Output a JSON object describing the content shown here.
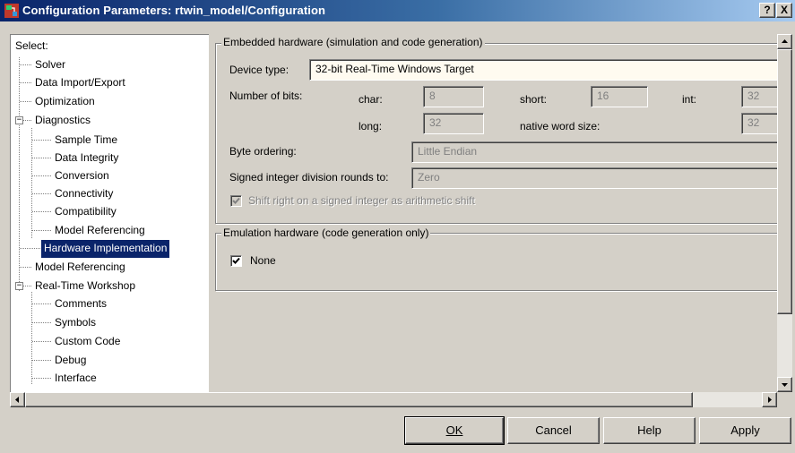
{
  "window": {
    "title": "Configuration Parameters: rtwin_model/Configuration",
    "help_button": "?",
    "close_button": "X"
  },
  "tree": {
    "select_label": "Select:",
    "items": [
      {
        "label": "Solver"
      },
      {
        "label": "Data Import/Export"
      },
      {
        "label": "Optimization"
      },
      {
        "label": "Diagnostics"
      },
      {
        "label": "Sample Time"
      },
      {
        "label": "Data Integrity"
      },
      {
        "label": "Conversion"
      },
      {
        "label": "Connectivity"
      },
      {
        "label": "Compatibility"
      },
      {
        "label": "Model Referencing"
      },
      {
        "label": "Hardware Implementation"
      },
      {
        "label": "Model Referencing"
      },
      {
        "label": "Real-Time Workshop"
      },
      {
        "label": "Comments"
      },
      {
        "label": "Symbols"
      },
      {
        "label": "Custom Code"
      },
      {
        "label": "Debug"
      },
      {
        "label": "Interface"
      }
    ],
    "selected": "Hardware Implementation"
  },
  "embedded": {
    "legend": "Embedded hardware (simulation and code generation)",
    "device_type_label": "Device type:",
    "device_type_value": "32-bit Real-Time Windows Target",
    "number_of_bits_label": "Number of bits:",
    "char_label": "char:",
    "char_value": "8",
    "short_label": "short:",
    "short_value": "16",
    "int_label": "int:",
    "int_value": "32",
    "long_label": "long:",
    "long_value": "32",
    "native_label": "native word size:",
    "native_value": "32",
    "byte_ordering_label": "Byte ordering:",
    "byte_ordering_value": "Little Endian",
    "signed_div_label": "Signed integer division rounds to:",
    "signed_div_value": "Zero",
    "shift_right_label": "Shift right on a signed integer as arithmetic shift",
    "shift_right_checked": true
  },
  "emulation": {
    "legend": "Emulation hardware (code generation only)",
    "none_label": "None",
    "none_checked": true
  },
  "buttons": {
    "ok": "OK",
    "cancel": "Cancel",
    "help": "Help",
    "apply": "Apply"
  },
  "colors": {
    "title_bar": "#0a246a",
    "selection": "#0a246a",
    "dialog_bg": "#d4d0c8"
  }
}
